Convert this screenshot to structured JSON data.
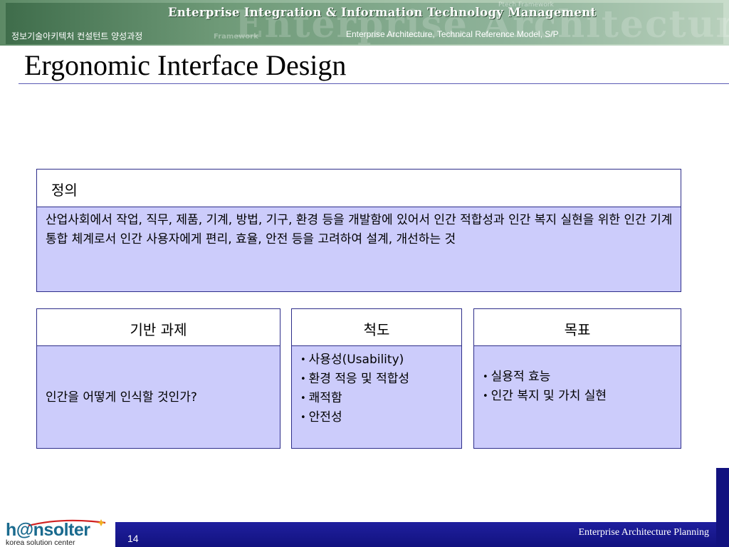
{
  "header": {
    "title": "Enterprise Integration & Information Technology Management",
    "subtitle_left": "정보기술아키텍처 컨설턴트 양성과정",
    "subtitle_right": "Enterprise Architecture, Technical Reference Model, S/P",
    "ghost_text": "Enterprise Architecture Model",
    "ghost_text_small": "Framework",
    "ghost_text_top": "Ptech Framework"
  },
  "slide": {
    "title": "Ergonomic Interface Design"
  },
  "definition": {
    "label": "정의",
    "text": "산업사회에서 작업, 직무, 제품, 기계, 방법, 기구, 환경 등을 개발함에 있어서 인간 적합성과 인간 복지 실현을 위한 인간 기계 통합 체계로서 인간 사용자에게 편리, 효율, 안전 등을 고려하여 설계, 개선하는 것"
  },
  "columns": {
    "basis": {
      "label": "기반 과제",
      "text": "인간을 어떻게 인식할 것인가?"
    },
    "measure": {
      "label": "척도",
      "items": [
        "사용성(Usability)",
        "환경 적응 및 적합성",
        "쾌적함",
        "안전성"
      ]
    },
    "goal": {
      "label": "목표",
      "items": [
        "실용적 효능",
        "인간 복지 및 가치 실현"
      ]
    }
  },
  "footer": {
    "page_number": "14",
    "text": "Enterprise Architecture Planning",
    "logo_text": "h@nsolter",
    "logo_subtext": "korea solution center"
  },
  "colors": {
    "box_fill": "#ccccfb",
    "box_border": "#2d2d8a",
    "footer_bar": "#12127f"
  }
}
